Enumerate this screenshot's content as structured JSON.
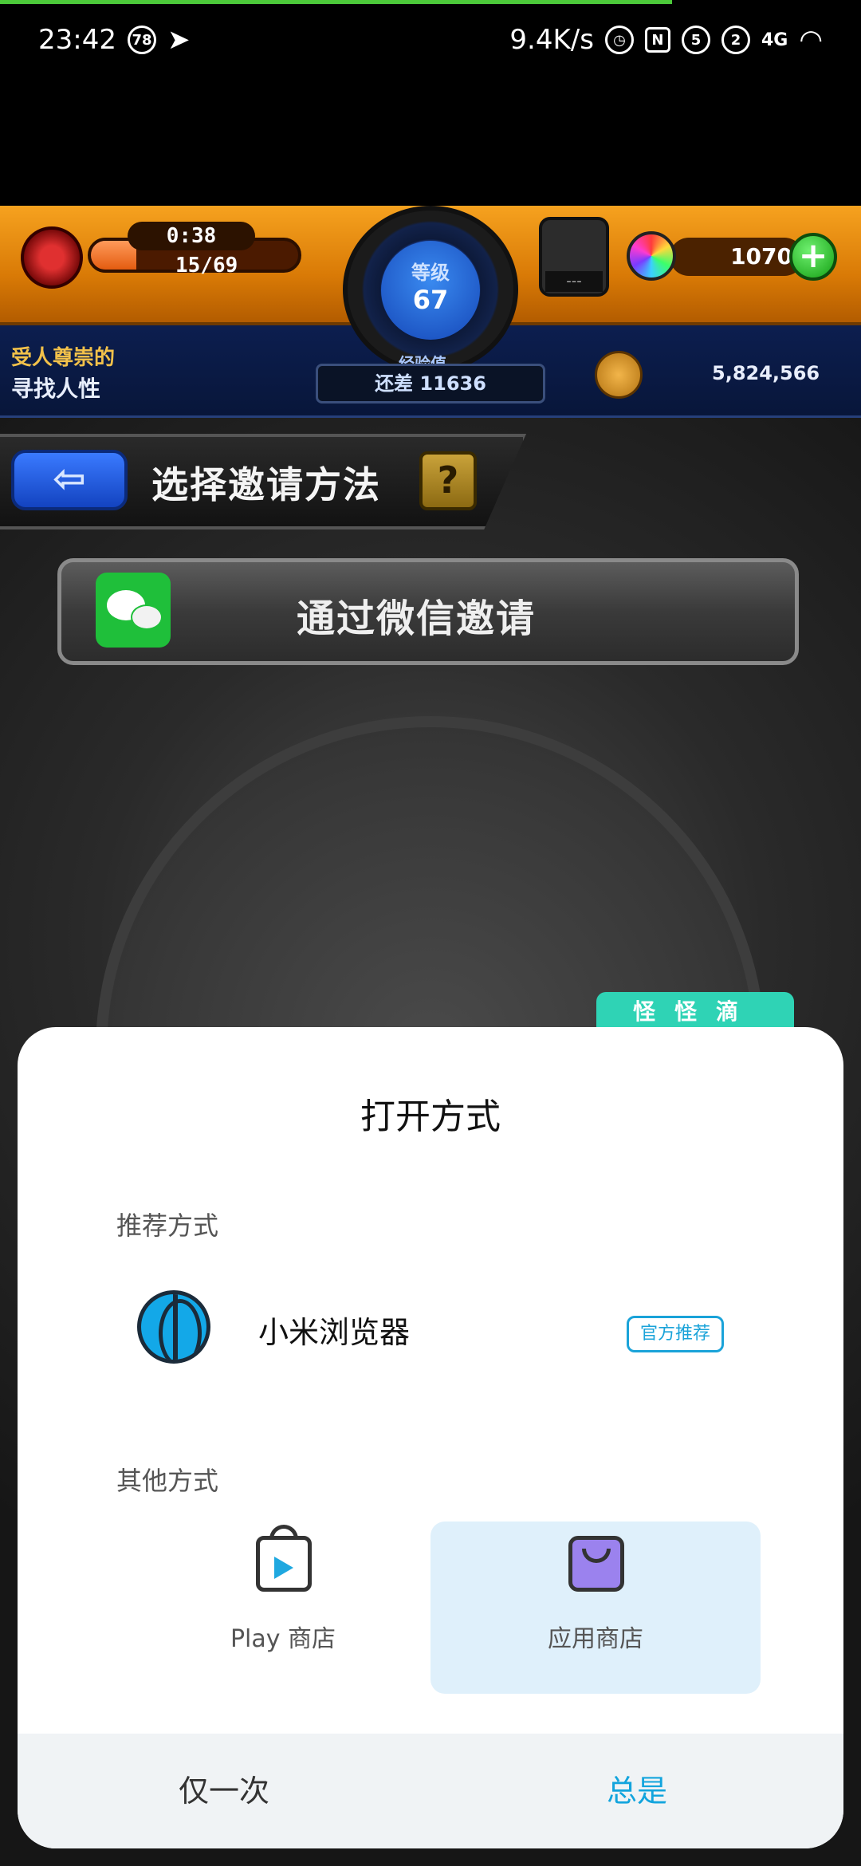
{
  "status_bar": {
    "time": "23:42",
    "notification_count": "78",
    "net_speed": "9.4K/s",
    "sim1": "5",
    "sim2": "2",
    "network": "4G"
  },
  "game": {
    "timer": "0:38",
    "energy": "15/69",
    "energy_fraction": 0.22,
    "level_label": "等级",
    "level_value": "67",
    "exp_label": "经验值",
    "exp_remaining": "还差 11636",
    "egg_display": "---",
    "gems": "1070",
    "plus_label": "+",
    "title_line1": "受人尊崇的",
    "title_line2": "寻找人性",
    "coins": "5,824,566",
    "header_title": "选择邀请方法",
    "help_label": "?",
    "back_label": "⇦",
    "wechat_button": "通过微信邀请",
    "tag_label": "怪怪滴"
  },
  "dialog": {
    "title": "打开方式",
    "recommended_label": "推荐方式",
    "browser_name": "小米浏览器",
    "official_badge": "官方推荐",
    "other_label": "其他方式",
    "options": [
      {
        "label": "Play 商店",
        "icon": "google-play-icon"
      },
      {
        "label": "应用商店",
        "icon": "app-store-bag-icon"
      }
    ],
    "once_button": "仅一次",
    "always_button": "总是"
  },
  "colors": {
    "accent": "#12a4dd",
    "selected_option_bg": "#dff0fb",
    "wechat_green": "#1fbf3a"
  }
}
